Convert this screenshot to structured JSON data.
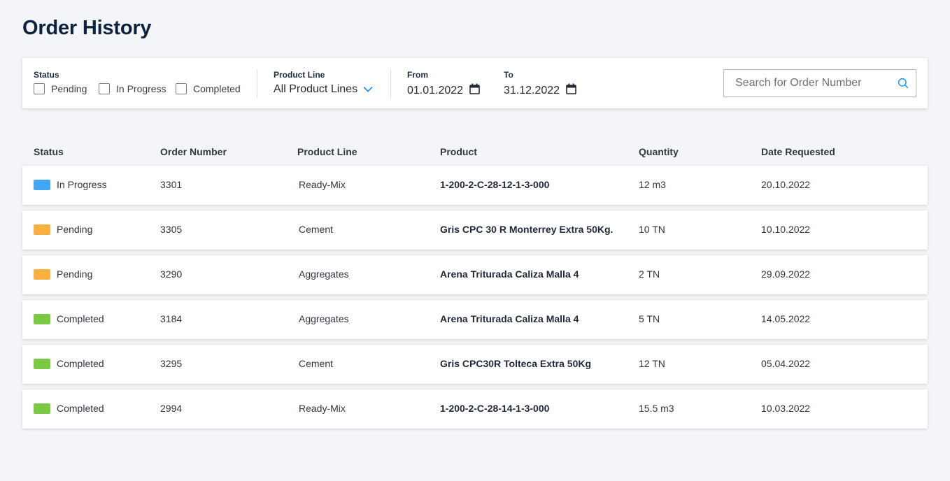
{
  "page": {
    "title": "Order History"
  },
  "filters": {
    "status_label": "Status",
    "status_options": [
      "Pending",
      "In Progress",
      "Completed"
    ],
    "product_line_label": "Product Line",
    "product_line_value": "All Product Lines",
    "from_label": "From",
    "from_value": "01.01.2022",
    "to_label": "To",
    "to_value": "31.12.2022",
    "search_placeholder": "Search for Order Number"
  },
  "table": {
    "headers": [
      "Status",
      "Order Number",
      "Product Line",
      "Product",
      "Quantity",
      "Date Requested"
    ],
    "rows": [
      {
        "status": "In Progress",
        "order_number": "3301",
        "product_line": "Ready-Mix",
        "product": "1-200-2-C-28-12-1-3-000",
        "quantity": "12 m3",
        "date": "20.10.2022"
      },
      {
        "status": "Pending",
        "order_number": "3305",
        "product_line": "Cement",
        "product": "Gris CPC 30 R Monterrey Extra 50Kg.",
        "quantity": "10 TN",
        "date": "10.10.2022"
      },
      {
        "status": "Pending",
        "order_number": "3290",
        "product_line": "Aggregates",
        "product": "Arena Triturada Caliza Malla 4",
        "quantity": "2 TN",
        "date": "29.09.2022"
      },
      {
        "status": "Completed",
        "order_number": "3184",
        "product_line": "Aggregates",
        "product": "Arena Triturada Caliza Malla 4",
        "quantity": "5 TN",
        "date": "14.05.2022"
      },
      {
        "status": "Completed",
        "order_number": "3295",
        "product_line": "Cement",
        "product": "Gris CPC30R Tolteca Extra 50Kg",
        "quantity": "12 TN",
        "date": "05.04.2022"
      },
      {
        "status": "Completed",
        "order_number": "2994",
        "product_line": "Ready-Mix",
        "product": "1-200-2-C-28-14-1-3-000",
        "quantity": "15.5 m3",
        "date": "10.03.2022"
      }
    ]
  },
  "colors": {
    "in_progress": "#42a5f5",
    "pending": "#fbb040",
    "completed": "#7ac943",
    "accent": "#2196f3",
    "title": "#0d2240"
  },
  "icons": {
    "dropdown": "chevron-down-icon",
    "date": "calendar-icon",
    "search": "search-icon"
  }
}
